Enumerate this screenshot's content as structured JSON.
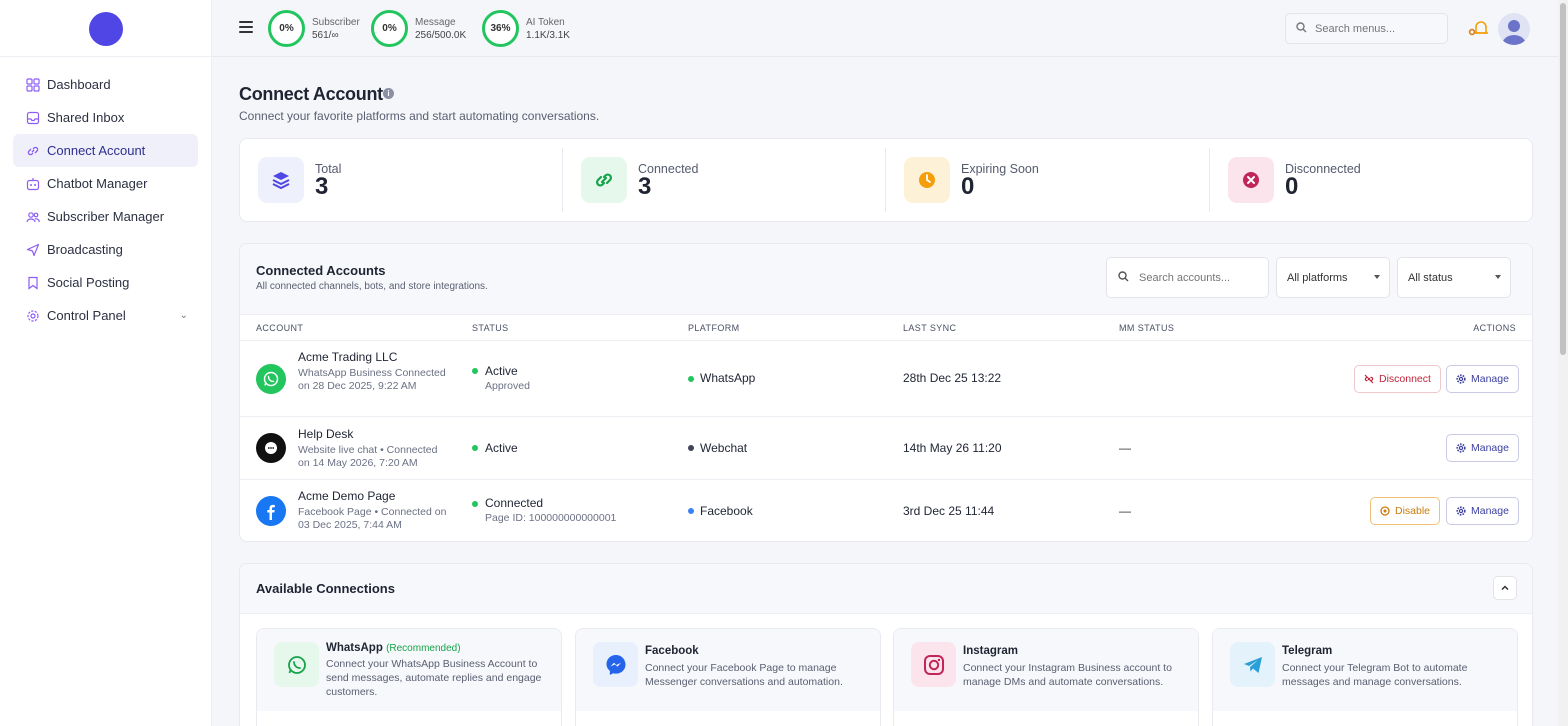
{
  "sidebar": {
    "items": [
      {
        "label": "Dashboard",
        "icon": "dashboard-icon"
      },
      {
        "label": "Shared Inbox",
        "icon": "inbox-icon"
      },
      {
        "label": "Connect Account",
        "icon": "link-icon"
      },
      {
        "label": "Chatbot Manager",
        "icon": "bot-icon"
      },
      {
        "label": "Subscriber Manager",
        "icon": "users-icon"
      },
      {
        "label": "Broadcasting",
        "icon": "send-icon"
      },
      {
        "label": "Social Posting",
        "icon": "bookmark-icon"
      },
      {
        "label": "Control Panel",
        "icon": "gear-icon"
      }
    ],
    "active_index": 2
  },
  "topbar": {
    "usage": [
      {
        "percent": "0%",
        "label": "Subscriber",
        "value": "561/∞"
      },
      {
        "percent": "0%",
        "label": "Message",
        "value": "256/500.0K"
      },
      {
        "percent": "36%",
        "label": "AI Token",
        "value": "1.1K/3.1K"
      }
    ],
    "search_placeholder": "Search menus..."
  },
  "page": {
    "title": "Connect Account",
    "subtitle": "Connect your favorite platforms and start automating conversations."
  },
  "stats": [
    {
      "label": "Total",
      "value": "3",
      "color": "#4f46e5",
      "bg": "#eef0fb"
    },
    {
      "label": "Connected",
      "value": "3",
      "color": "#16a34a",
      "bg": "#e6f7ec"
    },
    {
      "label": "Expiring Soon",
      "value": "0",
      "color": "#f59e0b",
      "bg": "#fdf2d8"
    },
    {
      "label": "Disconnected",
      "value": "0",
      "color": "#c0265a",
      "bg": "#fbe4ec"
    }
  ],
  "accounts": {
    "title": "Connected Accounts",
    "subtitle": "All connected channels, bots, and store integrations.",
    "search_placeholder": "Search accounts...",
    "platform_filter": "All platforms",
    "status_filter": "All status",
    "columns": [
      "ACCOUNT",
      "STATUS",
      "PLATFORM",
      "LAST SYNC",
      "MM STATUS",
      "ACTIONS"
    ],
    "rows": [
      {
        "name": "Acme Trading LLC",
        "desc": "WhatsApp Business Connected on 28 Dec 2025, 9:22 AM",
        "status": "Active",
        "status_sub": "Approved",
        "platform": "WhatsApp",
        "platform_color": "#22c55e",
        "last_sync": "28th Dec 25 13:22",
        "mm_status": "",
        "action1": "Disconnect",
        "manage": "Manage"
      },
      {
        "name": "Help Desk",
        "desc": "Website live chat • Connected on 14 May 2026, 7:20 AM",
        "status": "Active",
        "status_sub": "",
        "platform": "Webchat",
        "platform_color": "#3f4557",
        "last_sync": "14th May 26 11:20",
        "mm_status": "—",
        "action1": "",
        "manage": "Manage"
      },
      {
        "name": "Acme Demo Page",
        "desc": "Facebook Page • Connected on 03 Dec 2025, 7:44 AM",
        "status": "Connected",
        "status_sub": "Page ID: 100000000000001",
        "platform": "Facebook",
        "platform_color": "#3b82f6",
        "last_sync": "3rd Dec 25 11:44",
        "mm_status": "—",
        "action1": "Disable",
        "manage": "Manage"
      }
    ]
  },
  "available": {
    "title": "Available Connections",
    "items": [
      {
        "name": "WhatsApp",
        "tag": "(Recommended)",
        "desc": "Connect your WhatsApp Business Account to send messages, automate replies and engage customers.",
        "color": "#16a34a",
        "bg": "#e6f7ec"
      },
      {
        "name": "Facebook",
        "tag": "",
        "desc": "Connect your Facebook Page to manage Messenger conversations and automation.",
        "color": "#2563eb",
        "bg": "#e8effd"
      },
      {
        "name": "Instagram",
        "tag": "",
        "desc": "Connect your Instagram Business account to manage DMs and automate conversations.",
        "color": "#c0265a",
        "bg": "#fbe4ec"
      },
      {
        "name": "Telegram",
        "tag": "",
        "desc": "Connect your Telegram Bot to automate messages and manage conversations.",
        "color": "#2a9fd8",
        "bg": "#e3f2fb"
      }
    ]
  }
}
